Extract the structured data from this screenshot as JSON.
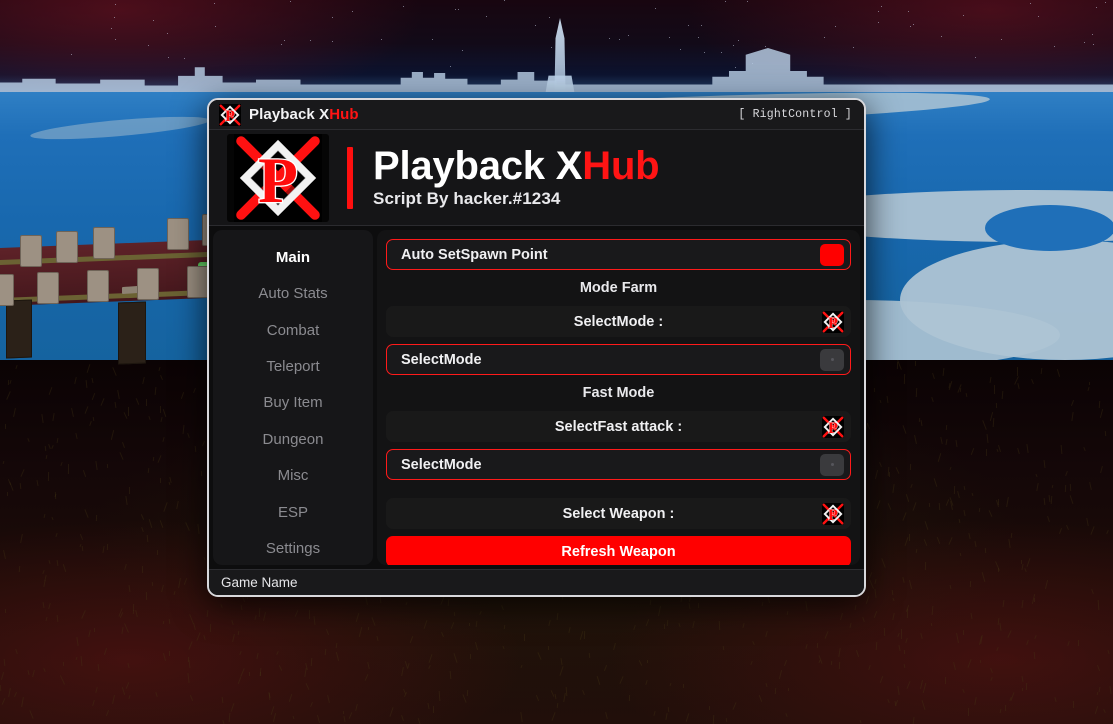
{
  "window": {
    "titlebar": {
      "logo_icon": "playback-p-logo-icon",
      "title_main": "Playback X",
      "title_accent": "Hub",
      "keybind": "[ RightControl ]"
    },
    "banner": {
      "logo_icon": "playback-p-logo-icon",
      "title_main": "Playback X",
      "title_accent": "Hub",
      "subtitle": "Script By hacker.#1234"
    },
    "statusbar": {
      "text": "Game Name"
    }
  },
  "sidebar": {
    "items": [
      {
        "label": "Main",
        "active": true
      },
      {
        "label": "Auto Stats",
        "active": false
      },
      {
        "label": "Combat",
        "active": false
      },
      {
        "label": "Teleport",
        "active": false
      },
      {
        "label": "Buy Item",
        "active": false
      },
      {
        "label": "Dungeon",
        "active": false
      },
      {
        "label": "Misc",
        "active": false
      },
      {
        "label": "ESP",
        "active": false
      },
      {
        "label": "Settings",
        "active": false
      }
    ]
  },
  "content": {
    "auto_setspawn": {
      "label": "Auto SetSpawn Point",
      "state": "on"
    },
    "section_mode_farm": "Mode Farm",
    "select_mode_dropdown": {
      "label": "SelectMode :",
      "icon": "playback-p-logo-icon"
    },
    "select_mode_toggle": {
      "label": "SelectMode",
      "state": "off"
    },
    "section_fast_mode": "Fast Mode",
    "select_fast_attack": {
      "label": "SelectFast attack :",
      "icon": "playback-p-logo-icon"
    },
    "fast_mode_toggle": {
      "label": "SelectMode",
      "state": "off"
    },
    "select_weapon": {
      "label": "Select Weapon :",
      "icon": "playback-p-logo-icon"
    },
    "refresh_weapon_button": "Refresh Weapon"
  },
  "colors": {
    "accent_red": "#ff0000",
    "border_red": "#ff1a1a",
    "panel_dark": "#131314",
    "sidebar_dark": "#161618",
    "text_primary": "#ffffff",
    "text_muted": "#8b8b90"
  }
}
